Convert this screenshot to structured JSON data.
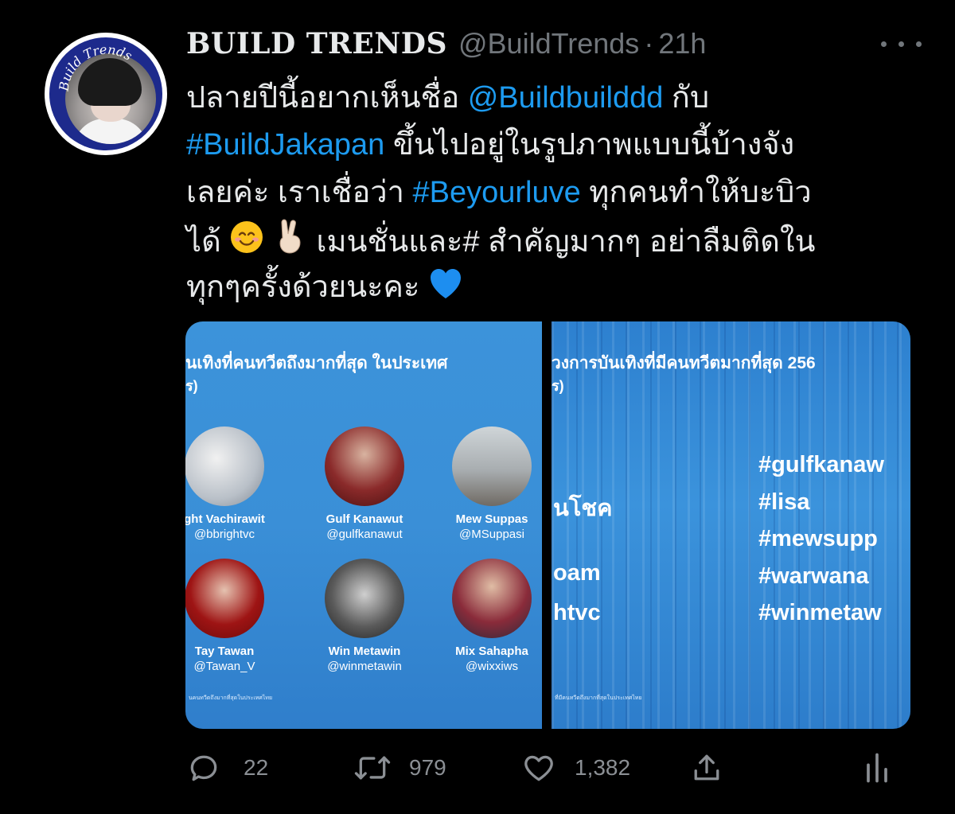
{
  "tweet": {
    "avatar_text": "Build Trends",
    "display_name": "BUILD TRENDS",
    "handle": "@BuildTrends",
    "separator": "·",
    "time": "21h",
    "text_lines": [
      [
        {
          "t": "ปลายปีนี้อยากเห็นชื่อ "
        },
        {
          "t": "@Buildbuilddd",
          "link": true
        },
        {
          "t": " กับ"
        }
      ],
      [
        {
          "t": "#BuildJakapan",
          "link": true
        },
        {
          "t": " ขึ้นไปอยู่ในรูปภาพแบบนี้บ้างจัง"
        }
      ],
      [
        {
          "t": "เลยค่ะ เราเชื่อว่า "
        },
        {
          "t": "#Beyourluve",
          "link": true
        },
        {
          "t": " ทุกคนทำให้บะบิว"
        }
      ],
      [
        {
          "t": "ได้ "
        },
        {
          "e": "smile"
        },
        {
          "t": " "
        },
        {
          "e": "victory"
        },
        {
          "t": "  เมนชั่นและ# สำคัญมากๆ อย่าลืมติดใน"
        }
      ],
      [
        {
          "t": "ทุกๆครั้งด้วยนะคะ "
        },
        {
          "e": "heart"
        }
      ]
    ]
  },
  "media": {
    "left": {
      "heading": "นเทิงที่คนทวีตถึงมากที่สุด ในประเทศ",
      "sub": "ร)",
      "people": [
        {
          "name": "ght Vachirawit",
          "handle": "@bbrightvc"
        },
        {
          "name": "Gulf Kanawut",
          "handle": "@gulfkanawut"
        },
        {
          "name": "Mew Suppas",
          "handle": "@MSuppasi"
        },
        {
          "name": "Tay Tawan",
          "handle": "@Tawan_V"
        },
        {
          "name": "Win Metawin",
          "handle": "@winmetawin"
        },
        {
          "name": "Mix Sahapha",
          "handle": "@wixxiws"
        }
      ],
      "footnote": "นคนทวีตถึงมากที่สุดในประเทศไทย"
    },
    "right": {
      "heading": "วงการบันเทิงที่มีคนทวีตมากที่สุด 256",
      "sub": "ร)",
      "left_items": [
        "นโชค",
        "oam",
        "htvc"
      ],
      "hashtags": [
        "#gulfkanaw",
        "#lisa",
        "#mewsupp",
        "#warwana",
        "#winmetaw"
      ],
      "footnote": "ที่มีคนทวีตถึงมากที่สุดในประเทศไทย"
    }
  },
  "actions": {
    "reply_count": "22",
    "retweet_count": "979",
    "like_count": "1,382"
  },
  "colors": {
    "background": "#000000",
    "text": "#e7e9ea",
    "secondary": "#71767b",
    "link": "#1d9bf0",
    "media_blue": "#3a8fd7"
  }
}
